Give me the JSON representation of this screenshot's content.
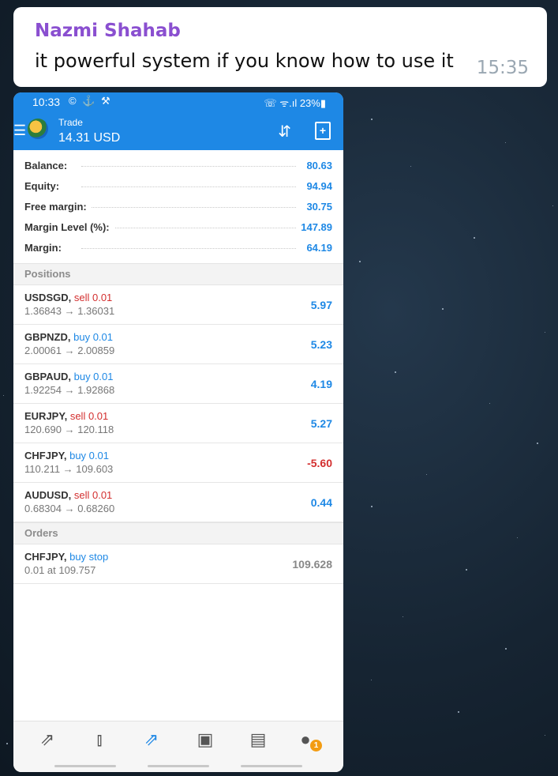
{
  "chat": {
    "sender": "Nazmi Shahab",
    "message": "it powerful system if you know how  to use it",
    "time": "15:35"
  },
  "phone": {
    "status": {
      "clock": "10:33",
      "left_icons": "© ⚓ ⚒",
      "right": "☏ ᯤ.ıl 23%▮"
    },
    "appbar": {
      "title": "Trade",
      "balance": "14.31 USD",
      "sort_icon": "⇵",
      "new_order_icon": "+"
    },
    "summary": [
      {
        "label": "Balance:",
        "value": "80.63"
      },
      {
        "label": "Equity:",
        "value": "94.94"
      },
      {
        "label": "Free margin:",
        "value": "30.75"
      },
      {
        "label": "Margin Level (%):",
        "value": "147.89"
      },
      {
        "label": "Margin:",
        "value": "64.19"
      }
    ],
    "positions_header": "Positions",
    "positions": [
      {
        "symbol": "USDSGD,",
        "side": "sell 0.01",
        "prices": "1.36843 → 1.36031",
        "profit": "5.97"
      },
      {
        "symbol": "GBPNZD,",
        "side": "buy 0.01",
        "prices": "2.00061 → 2.00859",
        "profit": "5.23"
      },
      {
        "symbol": "GBPAUD,",
        "side": "buy 0.01",
        "prices": "1.92254 → 1.92868",
        "profit": "4.19"
      },
      {
        "symbol": "EURJPY,",
        "side": "sell 0.01",
        "prices": "120.690 → 120.118",
        "profit": "5.27"
      },
      {
        "symbol": "CHFJPY,",
        "side": "buy 0.01",
        "prices": "110.211 → 109.603",
        "profit": "-5.60"
      },
      {
        "symbol": "AUDUSD,",
        "side": "sell 0.01",
        "prices": "0.68304 → 0.68260",
        "profit": "0.44"
      }
    ],
    "orders_header": "Orders",
    "orders": [
      {
        "symbol": "CHFJPY,",
        "side": "buy stop",
        "detail": "0.01 at 109.757",
        "price": "109.628"
      }
    ],
    "tabs": [
      {
        "name": "quotes-tab-icon",
        "glyph": "⇗"
      },
      {
        "name": "chart-tab-icon",
        "glyph": "⫾"
      },
      {
        "name": "trade-tab-icon",
        "glyph": "⇗"
      },
      {
        "name": "history-tab-icon",
        "glyph": "▣"
      },
      {
        "name": "news-tab-icon",
        "glyph": "▤"
      },
      {
        "name": "messages-tab-icon",
        "glyph": "●",
        "badge": "1"
      }
    ],
    "colors": {
      "accent": "#1e88e5",
      "sell": "#d32f2f",
      "buy": "#1e88e5",
      "badge": "#f39c12"
    }
  }
}
